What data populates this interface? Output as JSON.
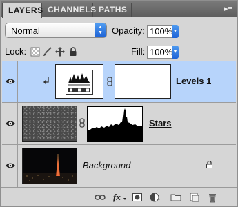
{
  "tabs": [
    {
      "label": "LAYERS",
      "active": true
    },
    {
      "label": "CHANNELS",
      "active": false
    },
    {
      "label": "PATHS",
      "active": false
    }
  ],
  "panel_menu_icon": "panel-menu-icon",
  "blend_mode": {
    "value": "Normal"
  },
  "opacity": {
    "label": "Opacity:",
    "value": "100%"
  },
  "lock": {
    "label": "Lock:",
    "icons": [
      "lock-transparent-icon",
      "lock-paint-icon",
      "lock-move-icon",
      "lock-all-icon"
    ]
  },
  "fill": {
    "label": "Fill:",
    "value": "100%"
  },
  "layers": [
    {
      "name": "Levels 1",
      "type": "adjustment",
      "selected": true,
      "visible": true,
      "clipped": true
    },
    {
      "name": "Stars",
      "type": "masked",
      "selected": false,
      "visible": true,
      "clipped": false
    },
    {
      "name": "Background",
      "type": "background",
      "selected": false,
      "visible": true,
      "locked": true
    }
  ],
  "footer_icons": [
    "link-layers-icon",
    "fx-icon",
    "add-mask-icon",
    "adjustment-layer-icon",
    "new-group-icon",
    "new-layer-icon",
    "trash-icon"
  ],
  "colors": {
    "selection": "#b7d4fb",
    "panel": "#d6d6d6",
    "accent_blue": "#1e63d6"
  }
}
